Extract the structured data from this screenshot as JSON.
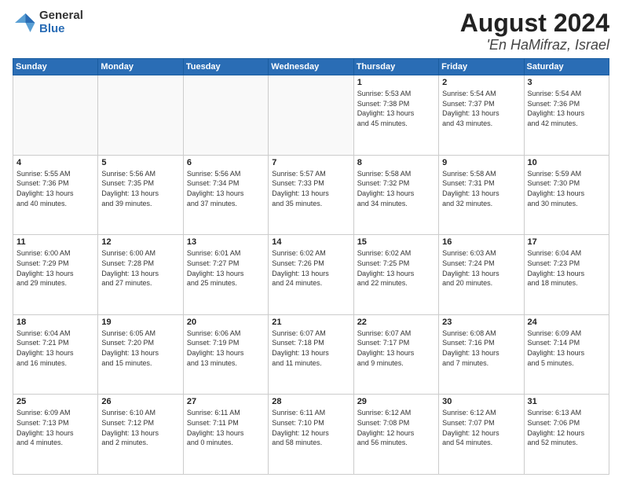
{
  "logo": {
    "general": "General",
    "blue": "Blue"
  },
  "header": {
    "month": "August 2024",
    "location": "'En HaMifraz, Israel"
  },
  "weekdays": [
    "Sunday",
    "Monday",
    "Tuesday",
    "Wednesday",
    "Thursday",
    "Friday",
    "Saturday"
  ],
  "weeks": [
    [
      {
        "day": "",
        "info": ""
      },
      {
        "day": "",
        "info": ""
      },
      {
        "day": "",
        "info": ""
      },
      {
        "day": "",
        "info": ""
      },
      {
        "day": "1",
        "info": "Sunrise: 5:53 AM\nSunset: 7:38 PM\nDaylight: 13 hours\nand 45 minutes."
      },
      {
        "day": "2",
        "info": "Sunrise: 5:54 AM\nSunset: 7:37 PM\nDaylight: 13 hours\nand 43 minutes."
      },
      {
        "day": "3",
        "info": "Sunrise: 5:54 AM\nSunset: 7:36 PM\nDaylight: 13 hours\nand 42 minutes."
      }
    ],
    [
      {
        "day": "4",
        "info": "Sunrise: 5:55 AM\nSunset: 7:36 PM\nDaylight: 13 hours\nand 40 minutes."
      },
      {
        "day": "5",
        "info": "Sunrise: 5:56 AM\nSunset: 7:35 PM\nDaylight: 13 hours\nand 39 minutes."
      },
      {
        "day": "6",
        "info": "Sunrise: 5:56 AM\nSunset: 7:34 PM\nDaylight: 13 hours\nand 37 minutes."
      },
      {
        "day": "7",
        "info": "Sunrise: 5:57 AM\nSunset: 7:33 PM\nDaylight: 13 hours\nand 35 minutes."
      },
      {
        "day": "8",
        "info": "Sunrise: 5:58 AM\nSunset: 7:32 PM\nDaylight: 13 hours\nand 34 minutes."
      },
      {
        "day": "9",
        "info": "Sunrise: 5:58 AM\nSunset: 7:31 PM\nDaylight: 13 hours\nand 32 minutes."
      },
      {
        "day": "10",
        "info": "Sunrise: 5:59 AM\nSunset: 7:30 PM\nDaylight: 13 hours\nand 30 minutes."
      }
    ],
    [
      {
        "day": "11",
        "info": "Sunrise: 6:00 AM\nSunset: 7:29 PM\nDaylight: 13 hours\nand 29 minutes."
      },
      {
        "day": "12",
        "info": "Sunrise: 6:00 AM\nSunset: 7:28 PM\nDaylight: 13 hours\nand 27 minutes."
      },
      {
        "day": "13",
        "info": "Sunrise: 6:01 AM\nSunset: 7:27 PM\nDaylight: 13 hours\nand 25 minutes."
      },
      {
        "day": "14",
        "info": "Sunrise: 6:02 AM\nSunset: 7:26 PM\nDaylight: 13 hours\nand 24 minutes."
      },
      {
        "day": "15",
        "info": "Sunrise: 6:02 AM\nSunset: 7:25 PM\nDaylight: 13 hours\nand 22 minutes."
      },
      {
        "day": "16",
        "info": "Sunrise: 6:03 AM\nSunset: 7:24 PM\nDaylight: 13 hours\nand 20 minutes."
      },
      {
        "day": "17",
        "info": "Sunrise: 6:04 AM\nSunset: 7:23 PM\nDaylight: 13 hours\nand 18 minutes."
      }
    ],
    [
      {
        "day": "18",
        "info": "Sunrise: 6:04 AM\nSunset: 7:21 PM\nDaylight: 13 hours\nand 16 minutes."
      },
      {
        "day": "19",
        "info": "Sunrise: 6:05 AM\nSunset: 7:20 PM\nDaylight: 13 hours\nand 15 minutes."
      },
      {
        "day": "20",
        "info": "Sunrise: 6:06 AM\nSunset: 7:19 PM\nDaylight: 13 hours\nand 13 minutes."
      },
      {
        "day": "21",
        "info": "Sunrise: 6:07 AM\nSunset: 7:18 PM\nDaylight: 13 hours\nand 11 minutes."
      },
      {
        "day": "22",
        "info": "Sunrise: 6:07 AM\nSunset: 7:17 PM\nDaylight: 13 hours\nand 9 minutes."
      },
      {
        "day": "23",
        "info": "Sunrise: 6:08 AM\nSunset: 7:16 PM\nDaylight: 13 hours\nand 7 minutes."
      },
      {
        "day": "24",
        "info": "Sunrise: 6:09 AM\nSunset: 7:14 PM\nDaylight: 13 hours\nand 5 minutes."
      }
    ],
    [
      {
        "day": "25",
        "info": "Sunrise: 6:09 AM\nSunset: 7:13 PM\nDaylight: 13 hours\nand 4 minutes."
      },
      {
        "day": "26",
        "info": "Sunrise: 6:10 AM\nSunset: 7:12 PM\nDaylight: 13 hours\nand 2 minutes."
      },
      {
        "day": "27",
        "info": "Sunrise: 6:11 AM\nSunset: 7:11 PM\nDaylight: 13 hours\nand 0 minutes."
      },
      {
        "day": "28",
        "info": "Sunrise: 6:11 AM\nSunset: 7:10 PM\nDaylight: 12 hours\nand 58 minutes."
      },
      {
        "day": "29",
        "info": "Sunrise: 6:12 AM\nSunset: 7:08 PM\nDaylight: 12 hours\nand 56 minutes."
      },
      {
        "day": "30",
        "info": "Sunrise: 6:12 AM\nSunset: 7:07 PM\nDaylight: 12 hours\nand 54 minutes."
      },
      {
        "day": "31",
        "info": "Sunrise: 6:13 AM\nSunset: 7:06 PM\nDaylight: 12 hours\nand 52 minutes."
      }
    ]
  ]
}
